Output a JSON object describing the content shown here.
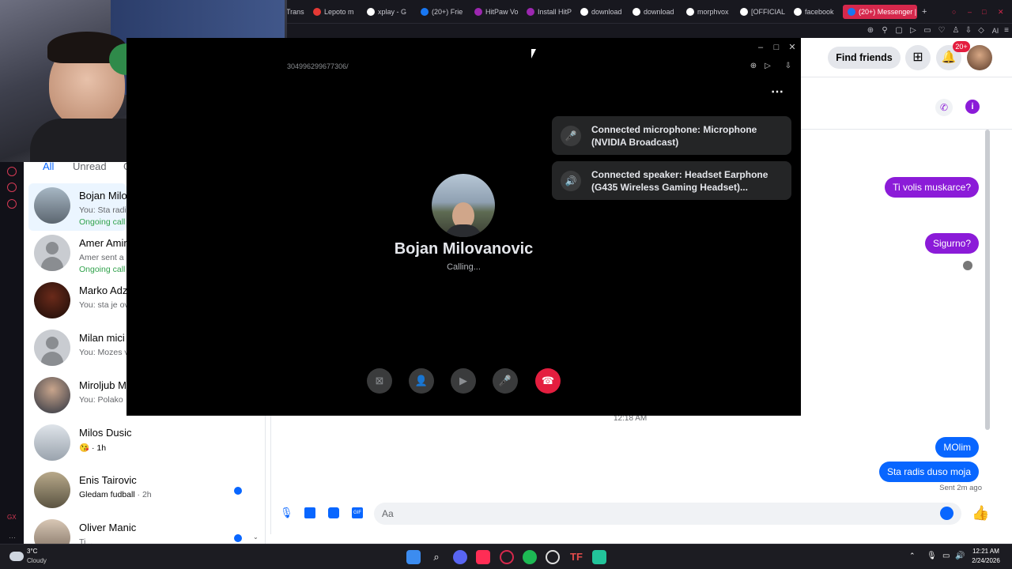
{
  "browser": {
    "tabs": [
      {
        "label": "Trans",
        "color": "#e53935"
      },
      {
        "label": "Lepoto m",
        "color": "#e53935"
      },
      {
        "label": "xplay - G",
        "color": "#ffffff"
      },
      {
        "label": "(20+) Frie",
        "color": "#1877f2"
      },
      {
        "label": "HitPaw Vo",
        "color": "#9c27b0"
      },
      {
        "label": "Install HitP",
        "color": "#9c27b0"
      },
      {
        "label": "download",
        "color": "#ffffff"
      },
      {
        "label": "download",
        "color": "#ffffff"
      },
      {
        "label": "morphvox",
        "color": "#ffffff"
      },
      {
        "label": "[OFFICIAL",
        "color": "#ffffff"
      },
      {
        "label": "facebook",
        "color": "#ffffff"
      },
      {
        "label": "(20+) Messenger |",
        "color": "#1877f2"
      }
    ],
    "toolbar_ai": "AI",
    "url_fragment": "3049962996773​06/"
  },
  "left_list": {
    "filters": [
      "All",
      "Unread",
      "G"
    ],
    "conversations": [
      {
        "name": "Bojan Milo",
        "preview": "You: Sta radis",
        "status": "Ongoing call",
        "selected": true,
        "avatar": "photo"
      },
      {
        "name": "Amer Amir",
        "preview": "Amer sent a",
        "status": "Ongoing call",
        "avatar": "gray"
      },
      {
        "name": "Marko Adz",
        "preview": "You: sta je ov",
        "avatar": "photo"
      },
      {
        "name": "Milan mici",
        "preview": "You: Mozes v",
        "avatar": "gray"
      },
      {
        "name": "Miroljub M",
        "preview": "You: Polako",
        "avatar": "photo"
      },
      {
        "name": "Milos Dusic",
        "preview": "😘 · 1h",
        "avatar": "photo"
      },
      {
        "name": "Enis Tairovic",
        "preview": "Gledam fudball",
        "time": " · 2h",
        "unread": true,
        "avatar": "photo"
      },
      {
        "name": "Oliver Manic",
        "preview": "Ti...",
        "unread": true,
        "avatar": "photo"
      }
    ]
  },
  "topnav": {
    "find_friends": "Find friends",
    "notif_badge": "20+"
  },
  "chat": {
    "messages": [
      {
        "text": "Ti volis muskarce?",
        "style": "purple"
      },
      {
        "text": "Sigurno?",
        "style": "purple"
      },
      {
        "text": "MOlim",
        "style": "blue"
      },
      {
        "text": "Sta radis duso moja",
        "style": "blue"
      }
    ],
    "timestamp": "12:18 AM",
    "sent_status": "Sent 2m ago",
    "input_placeholder": "Aa"
  },
  "call": {
    "name": "Bojan Milovanovic",
    "status": "Calling...",
    "mic_notice": "Connected microphone: Microphone (NVIDIA Broadcast)",
    "speaker_notice": "Connected speaker: Headset Earphone (G435 Wireless Gaming Headset)..."
  },
  "taskbar": {
    "weather_temp": "3°C",
    "weather_desc": "Cloudy",
    "time": "12:21 AM",
    "date": "2/24/2026"
  }
}
